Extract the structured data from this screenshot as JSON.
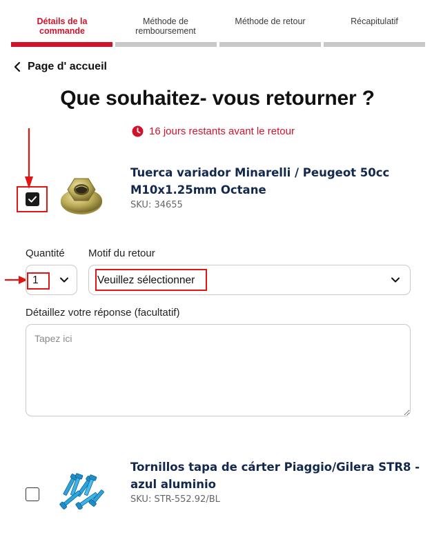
{
  "stepper": [
    {
      "label": "Détails de la commande",
      "active": true
    },
    {
      "label": "Méthode de remboursement",
      "active": false
    },
    {
      "label": "Méthode de retour",
      "active": false
    },
    {
      "label": "Récapitulatif",
      "active": false
    }
  ],
  "back_label": "Page d' accueil",
  "title": "Que souhaitez- vous retourner ?",
  "remaining": "16 jours restants avant le retour",
  "products": [
    {
      "title": "Tuerca variador Minarelli / Peugeot 50cc M10x1.25mm Octane",
      "sku": "SKU: 34655",
      "checked": true
    },
    {
      "title": "Tornillos tapa de cárter Piaggio/Gilera STR8 - azul aluminio",
      "sku": "SKU: STR-552.92/BL",
      "checked": false
    }
  ],
  "form": {
    "quantity_label": "Quantité",
    "quantity_value": "1",
    "reason_label": "Motif du retour",
    "reason_value": "Veuillez sélectionner",
    "details_label": "Détaillez votre réponse (facultatif)",
    "details_placeholder": "Tapez ici"
  },
  "colors": {
    "accent": "#d0132b",
    "annotation": "#e01616",
    "product_title": "#13284d"
  }
}
